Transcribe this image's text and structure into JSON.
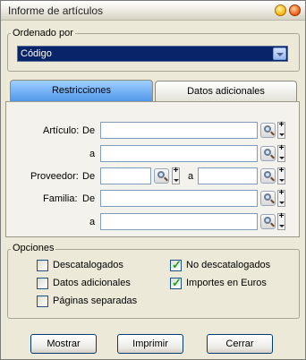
{
  "window": {
    "title": "Informe de artículos"
  },
  "ordenado": {
    "legend": "Ordenado por",
    "selected": "Código"
  },
  "tabs": [
    {
      "label": "Restricciones"
    },
    {
      "label": "Datos adicionales"
    }
  ],
  "filters": {
    "articulo_label": "Artículo:",
    "de_label": "De",
    "a_label": "a",
    "proveedor_label": "Proveedor:",
    "familia_label": "Familia:",
    "articulo_de": "",
    "articulo_a": "",
    "proveedor_de": "",
    "proveedor_a": "",
    "familia_de": "",
    "familia_a": "",
    "plus": "+"
  },
  "opciones": {
    "legend": "Opciones",
    "items": [
      {
        "label": "Descatalogados",
        "checked": false
      },
      {
        "label": "Datos adicionales",
        "checked": false
      },
      {
        "label": "Páginas separadas",
        "checked": false
      },
      {
        "label": "No descatalogados",
        "checked": true
      },
      {
        "label": "Importes en Euros",
        "checked": true
      }
    ]
  },
  "buttons": {
    "mostrar": "Mostrar",
    "imprimir": "Imprimir",
    "cerrar": "Cerrar"
  }
}
